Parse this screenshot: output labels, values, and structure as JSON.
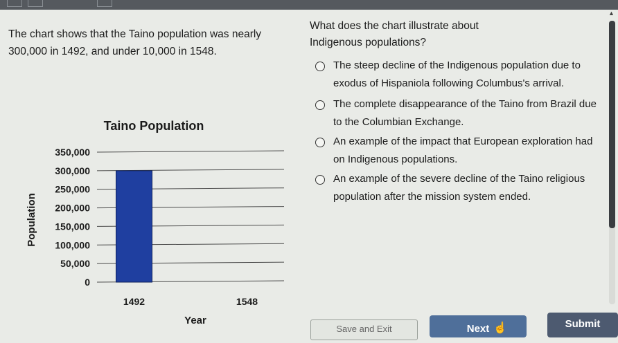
{
  "passage": {
    "text": "The chart shows that the Taino population was nearly 300,000 in 1492, and under 10,000 in 1548."
  },
  "question": {
    "text": "What does the chart illustrate about Indigenous populations?",
    "options": [
      {
        "label": "The steep decline of the Indigenous population due to exodus of Hispaniola following Columbus's arrival."
      },
      {
        "label": "The complete disappearance of the Taino from Brazil due to the Columbian Exchange."
      },
      {
        "label": "An example of the impact that European exploration had on Indigenous populations."
      },
      {
        "label": "An example of the severe decline of the Taino religious population after the mission system ended."
      }
    ]
  },
  "chart_data": {
    "type": "bar",
    "title": "Taino Population",
    "xlabel": "Year",
    "ylabel": "Population",
    "categories": [
      "1492",
      "1548"
    ],
    "values": [
      300000,
      0
    ],
    "ylim": [
      0,
      350000
    ],
    "yticks": [
      "0",
      "50,000",
      "100,000",
      "150,000",
      "200,000",
      "250,000",
      "300,000",
      "350,000"
    ],
    "grid": true,
    "bar_color": "#1f3fa0"
  },
  "footer": {
    "exit_label": "Save and Exit",
    "next_label": "Next",
    "submit_label": "Submit"
  }
}
